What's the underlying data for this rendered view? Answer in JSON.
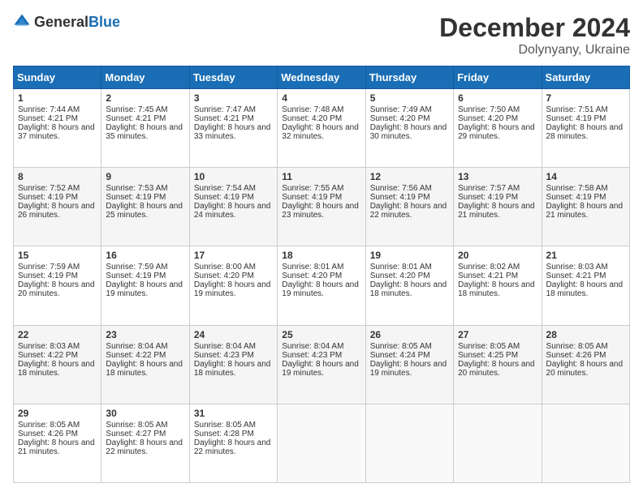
{
  "header": {
    "logo_general": "General",
    "logo_blue": "Blue",
    "month_title": "December 2024",
    "location": "Dolynyany, Ukraine"
  },
  "days": [
    "Sunday",
    "Monday",
    "Tuesday",
    "Wednesday",
    "Thursday",
    "Friday",
    "Saturday"
  ],
  "weeks": [
    [
      {
        "day": "1",
        "sunrise": "7:44 AM",
        "sunset": "4:21 PM",
        "daylight": "8 hours and 37 minutes."
      },
      {
        "day": "2",
        "sunrise": "7:45 AM",
        "sunset": "4:21 PM",
        "daylight": "8 hours and 35 minutes."
      },
      {
        "day": "3",
        "sunrise": "7:47 AM",
        "sunset": "4:21 PM",
        "daylight": "8 hours and 33 minutes."
      },
      {
        "day": "4",
        "sunrise": "7:48 AM",
        "sunset": "4:20 PM",
        "daylight": "8 hours and 32 minutes."
      },
      {
        "day": "5",
        "sunrise": "7:49 AM",
        "sunset": "4:20 PM",
        "daylight": "8 hours and 30 minutes."
      },
      {
        "day": "6",
        "sunrise": "7:50 AM",
        "sunset": "4:20 PM",
        "daylight": "8 hours and 29 minutes."
      },
      {
        "day": "7",
        "sunrise": "7:51 AM",
        "sunset": "4:19 PM",
        "daylight": "8 hours and 28 minutes."
      }
    ],
    [
      {
        "day": "8",
        "sunrise": "7:52 AM",
        "sunset": "4:19 PM",
        "daylight": "8 hours and 26 minutes."
      },
      {
        "day": "9",
        "sunrise": "7:53 AM",
        "sunset": "4:19 PM",
        "daylight": "8 hours and 25 minutes."
      },
      {
        "day": "10",
        "sunrise": "7:54 AM",
        "sunset": "4:19 PM",
        "daylight": "8 hours and 24 minutes."
      },
      {
        "day": "11",
        "sunrise": "7:55 AM",
        "sunset": "4:19 PM",
        "daylight": "8 hours and 23 minutes."
      },
      {
        "day": "12",
        "sunrise": "7:56 AM",
        "sunset": "4:19 PM",
        "daylight": "8 hours and 22 minutes."
      },
      {
        "day": "13",
        "sunrise": "7:57 AM",
        "sunset": "4:19 PM",
        "daylight": "8 hours and 21 minutes."
      },
      {
        "day": "14",
        "sunrise": "7:58 AM",
        "sunset": "4:19 PM",
        "daylight": "8 hours and 21 minutes."
      }
    ],
    [
      {
        "day": "15",
        "sunrise": "7:59 AM",
        "sunset": "4:19 PM",
        "daylight": "8 hours and 20 minutes."
      },
      {
        "day": "16",
        "sunrise": "7:59 AM",
        "sunset": "4:19 PM",
        "daylight": "8 hours and 19 minutes."
      },
      {
        "day": "17",
        "sunrise": "8:00 AM",
        "sunset": "4:20 PM",
        "daylight": "8 hours and 19 minutes."
      },
      {
        "day": "18",
        "sunrise": "8:01 AM",
        "sunset": "4:20 PM",
        "daylight": "8 hours and 19 minutes."
      },
      {
        "day": "19",
        "sunrise": "8:01 AM",
        "sunset": "4:20 PM",
        "daylight": "8 hours and 18 minutes."
      },
      {
        "day": "20",
        "sunrise": "8:02 AM",
        "sunset": "4:21 PM",
        "daylight": "8 hours and 18 minutes."
      },
      {
        "day": "21",
        "sunrise": "8:03 AM",
        "sunset": "4:21 PM",
        "daylight": "8 hours and 18 minutes."
      }
    ],
    [
      {
        "day": "22",
        "sunrise": "8:03 AM",
        "sunset": "4:22 PM",
        "daylight": "8 hours and 18 minutes."
      },
      {
        "day": "23",
        "sunrise": "8:04 AM",
        "sunset": "4:22 PM",
        "daylight": "8 hours and 18 minutes."
      },
      {
        "day": "24",
        "sunrise": "8:04 AM",
        "sunset": "4:23 PM",
        "daylight": "8 hours and 18 minutes."
      },
      {
        "day": "25",
        "sunrise": "8:04 AM",
        "sunset": "4:23 PM",
        "daylight": "8 hours and 19 minutes."
      },
      {
        "day": "26",
        "sunrise": "8:05 AM",
        "sunset": "4:24 PM",
        "daylight": "8 hours and 19 minutes."
      },
      {
        "day": "27",
        "sunrise": "8:05 AM",
        "sunset": "4:25 PM",
        "daylight": "8 hours and 20 minutes."
      },
      {
        "day": "28",
        "sunrise": "8:05 AM",
        "sunset": "4:26 PM",
        "daylight": "8 hours and 20 minutes."
      }
    ],
    [
      {
        "day": "29",
        "sunrise": "8:05 AM",
        "sunset": "4:26 PM",
        "daylight": "8 hours and 21 minutes."
      },
      {
        "day": "30",
        "sunrise": "8:05 AM",
        "sunset": "4:27 PM",
        "daylight": "8 hours and 22 minutes."
      },
      {
        "day": "31",
        "sunrise": "8:05 AM",
        "sunset": "4:28 PM",
        "daylight": "8 hours and 22 minutes."
      },
      null,
      null,
      null,
      null
    ]
  ],
  "labels": {
    "sunrise": "Sunrise:",
    "sunset": "Sunset:",
    "daylight": "Daylight:"
  }
}
